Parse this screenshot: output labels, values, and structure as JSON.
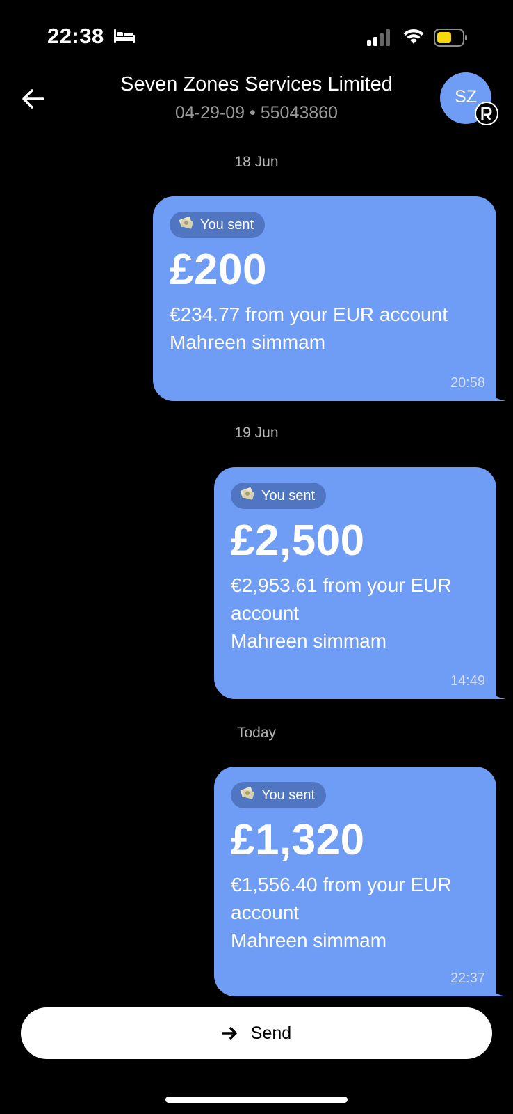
{
  "status_bar": {
    "time": "22:38",
    "icons": [
      "bed-icon",
      "signal-icon",
      "wifi-icon",
      "battery-icon"
    ],
    "battery_color": "#f5d90a"
  },
  "header": {
    "title": "Seven Zones Services Limited",
    "subtitle": "04-29-09 • 55043860",
    "avatar_initials": "SZ",
    "avatar_color": "#6f9cf5",
    "badge_icon": "revolut-r-icon",
    "back_icon": "arrow-left-icon"
  },
  "messages": [
    {
      "date": "18 Jun",
      "pill_label": "You sent",
      "pill_icon": "money-icon",
      "amount": "£200",
      "detail_lines": [
        "€234.77 from your EUR account",
        "Mahreen simmam"
      ],
      "time": "20:58"
    },
    {
      "date": "19 Jun",
      "pill_label": "You sent",
      "pill_icon": "money-icon",
      "amount": "£2,500",
      "detail_lines": [
        "€2,953.61 from your EUR",
        "account",
        "Mahreen simmam"
      ],
      "time": "14:49"
    },
    {
      "date": "Today",
      "pill_label": "You sent",
      "pill_icon": "money-icon",
      "amount": "£1,320",
      "detail_lines": [
        "€1,556.40 from your EUR",
        "account",
        "Mahreen simmam"
      ],
      "time": "22:37"
    }
  ],
  "footer": {
    "send_label": "Send",
    "send_icon": "arrow-right-icon"
  },
  "colors": {
    "bubble": "#6f9cf5",
    "background": "#000000"
  }
}
